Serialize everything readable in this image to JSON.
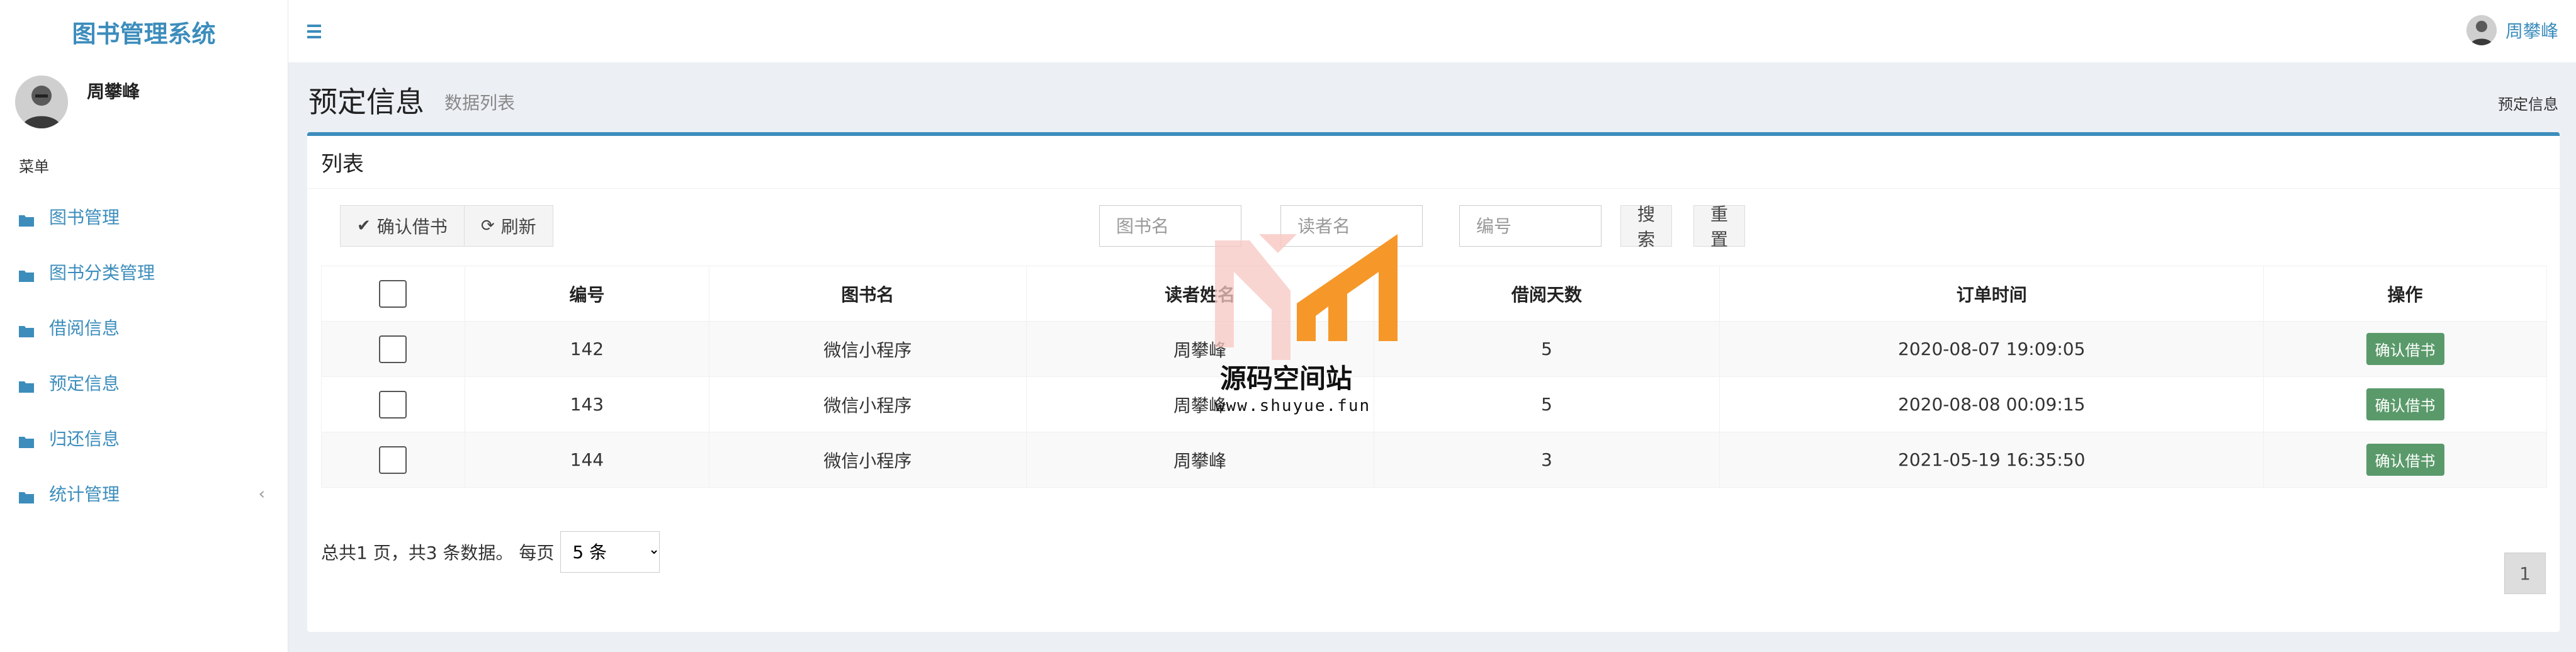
{
  "app": {
    "title": "图书管理系统"
  },
  "user": {
    "name": "周攀峰"
  },
  "sidebar": {
    "menu_header": "菜单",
    "items": [
      {
        "label": "图书管理",
        "icon": "folder-icon"
      },
      {
        "label": "图书分类管理",
        "icon": "folder-icon"
      },
      {
        "label": "借阅信息",
        "icon": "folder-icon"
      },
      {
        "label": "预定信息",
        "icon": "folder-icon"
      },
      {
        "label": "归还信息",
        "icon": "folder-icon"
      },
      {
        "label": "统计管理",
        "icon": "folder-icon",
        "expand_glyph": "‹"
      }
    ]
  },
  "page": {
    "title": "预定信息",
    "subtitle": "数据列表",
    "breadcrumb": "预定信息"
  },
  "box": {
    "title": "列表",
    "toolbar": {
      "confirm_label": "确认借书",
      "refresh_label": "刷新"
    },
    "search": {
      "book_name_placeholder": "图书名",
      "reader_name_placeholder": "读者名",
      "number_placeholder": "编号",
      "search_label": "搜索",
      "reset_label": "重置"
    },
    "table": {
      "headers": [
        "编号",
        "图书名",
        "读者姓名",
        "借阅天数",
        "订单时间",
        "操作"
      ],
      "rows": [
        {
          "id": "142",
          "book": "微信小程序",
          "reader": "周攀峰",
          "days": "5",
          "time": "2020-08-07 19:09:05",
          "action": "确认借书"
        },
        {
          "id": "143",
          "book": "微信小程序",
          "reader": "周攀峰",
          "days": "5",
          "time": "2020-08-08 00:09:15",
          "action": "确认借书"
        },
        {
          "id": "144",
          "book": "微信小程序",
          "reader": "周攀峰",
          "days": "3",
          "time": "2021-05-19 16:35:50",
          "action": "确认借书"
        }
      ]
    },
    "pagination": {
      "info": "总共1 页，共3 条数据。 每页",
      "page_size_selected": "5 条",
      "current_page": "1"
    }
  },
  "watermark": {
    "text": "源码空间站",
    "url": "www.shuyue.fun"
  },
  "colors": {
    "accent": "#3c8dbc",
    "op_button": "#5a9a6a",
    "watermark_orange": "#f5911e",
    "watermark_pink": "#f7c7c2"
  }
}
